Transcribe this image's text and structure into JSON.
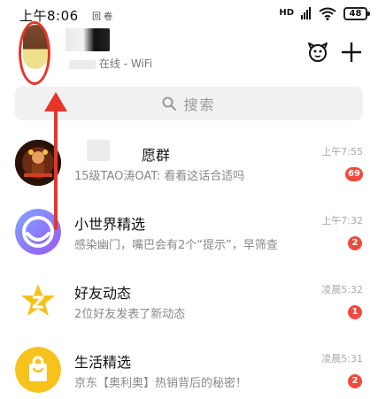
{
  "status_bar": {
    "time": "上午8:06",
    "extra": "回 卷",
    "signal": "HD",
    "battery": "48"
  },
  "header": {
    "account_status": "- WiFi",
    "account_prefix": "在线",
    "icons": [
      "mascot-icon",
      "plus-icon"
    ]
  },
  "search": {
    "placeholder": "搜索"
  },
  "chats": [
    {
      "title": "愿群",
      "preview": "15级TAO涛OAT: 看看这话合适吗",
      "time": "上午7:55",
      "badge": "69"
    },
    {
      "title": "小世界精选",
      "preview": "感染幽门，嘴巴会有2个“提示”，早筛查",
      "time": "上午7:32",
      "badge": "2"
    },
    {
      "title": "好友动态",
      "preview": "2位好友发表了新动态",
      "time": "凌晨5:32",
      "badge": "1"
    },
    {
      "title": "生活精选",
      "preview": "京东【奥利奥】热销背后的秘密！",
      "time": "凌晨5:31",
      "badge": "2"
    }
  ],
  "colors": {
    "badge": "#f04a3e",
    "annotation": "#e8352a",
    "search_bg": "#f1f1f2"
  }
}
